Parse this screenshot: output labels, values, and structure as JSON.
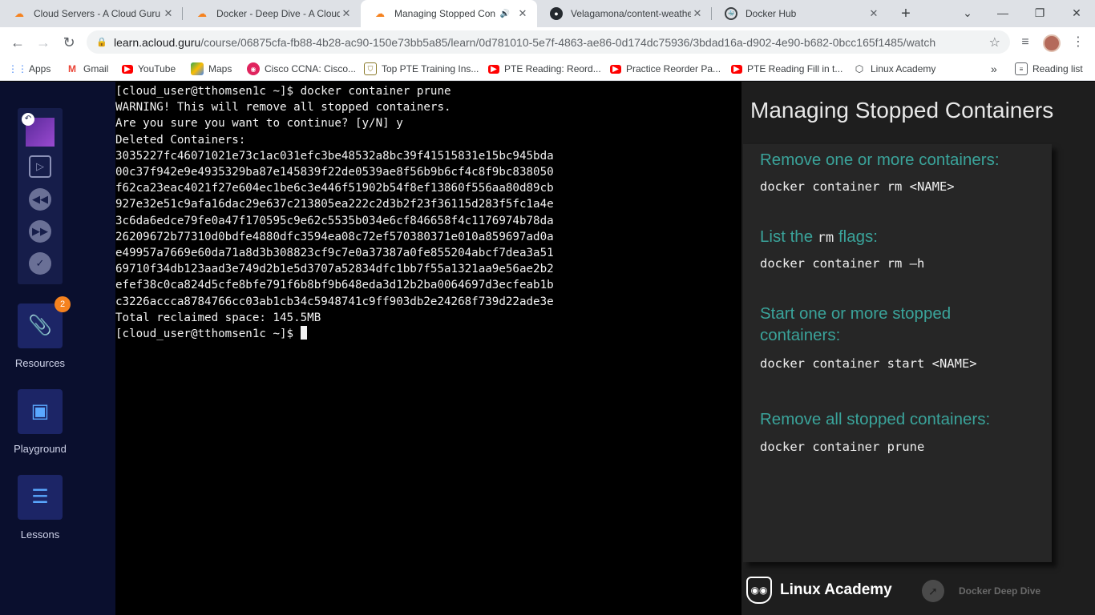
{
  "browser": {
    "tabs": [
      {
        "title": "Cloud Servers - A Cloud Guru",
        "icon": "cloud-icon",
        "active": false
      },
      {
        "title": "Docker - Deep Dive - A Cloud",
        "icon": "cloud-icon",
        "active": false
      },
      {
        "title": "Managing Stopped Conta",
        "icon": "cloud-icon",
        "active": true,
        "audio": "🔊"
      },
      {
        "title": "Velagamona/content-weathe",
        "icon": "github-icon",
        "active": false
      },
      {
        "title": "Docker Hub",
        "icon": "docker-icon",
        "active": false
      }
    ],
    "url_host": "learn.acloud.guru",
    "url_path": "/course/06875cfa-fb88-4b28-ac90-150e73bb5a85/learn/0d781010-5e7f-4863-ae86-0d174dc75936/3bdad16a-d902-4e90-b682-0bcc165f1485/watch",
    "bookmarks": [
      {
        "label": "Apps",
        "icon": "apps-grid-icon"
      },
      {
        "label": "Gmail",
        "icon": "gmail-icon"
      },
      {
        "label": "YouTube",
        "icon": "youtube-icon"
      },
      {
        "label": "Maps",
        "icon": "maps-icon"
      },
      {
        "label": "Cisco CCNA: Cisco...",
        "icon": "cisco-icon"
      },
      {
        "label": "Top PTE Training Ins...",
        "icon": "pte-icon"
      },
      {
        "label": "PTE Reading: Reord...",
        "icon": "youtube-icon"
      },
      {
        "label": "Practice Reorder Pa...",
        "icon": "youtube-icon"
      },
      {
        "label": "PTE Reading Fill in t...",
        "icon": "youtube-icon"
      },
      {
        "label": "Linux Academy",
        "icon": "linux-academy-icon"
      }
    ],
    "bookmarks_overflow": "»",
    "reading_list": "Reading list"
  },
  "sidebar": {
    "resources_label": "Resources",
    "resources_badge": "2",
    "playground_label": "Playground",
    "lessons_label": "Lessons"
  },
  "terminal": {
    "lines": [
      "[cloud_user@tthomsen1c ~]$ docker container prune",
      "WARNING! This will remove all stopped containers.",
      "Are you sure you want to continue? [y/N] y",
      "Deleted Containers:",
      "3035227fc46071021e73c1ac031efc3be48532a8bc39f41515831e15bc945bda",
      "00c37f942e9e4935329ba87e145839f22de0539ae8f56b9b6cf4c8f9bc838050",
      "f62ca23eac4021f27e604ec1be6c3e446f51902b54f8ef13860f556aa80d89cb",
      "927e32e51c9afa16dac29e637c213805ea222c2d3b2f23f36115d283f5fc1a4e",
      "3c6da6edce79fe0a47f170595c9e62c5535b034e6cf846658f4c1176974b78da",
      "26209672b77310d0bdfe4880dfc3594ea08c72ef570380371e010a859697ad0a",
      "e49957a7669e60da71a8d3b308823cf9c7e0a37387a0fe855204abcf7dea3a51",
      "69710f34db123aad3e749d2b1e5d3707a52834dfc1bb7f55a1321aa9e56ae2b2",
      "efef38c0ca824d5cfe8bfe791f6b8bf9b648eda3d12b2ba0064697d3ecfeab1b",
      "c3226accca8784766cc03ab1cb34c5948741c9ff903db2e24268f739d22ade3e",
      "",
      "Total reclaimed space: 145.5MB"
    ],
    "prompt": "[cloud_user@tthomsen1c ~]$ "
  },
  "slide": {
    "title": "Managing Stopped Containers",
    "sections": [
      {
        "head": "Remove one or more containers:",
        "cmd": "docker container rm <NAME>"
      },
      {
        "head_pre": "List the ",
        "head_mono": "rm",
        "head_post": " flags:",
        "cmd": "docker container rm –h"
      },
      {
        "head": "Start one or more stopped",
        "head2": "containers:",
        "cmd": "docker container start <NAME>"
      },
      {
        "head": "Remove all stopped containers:",
        "cmd": "docker container prune"
      }
    ],
    "brand": "Linux Academy",
    "course": "Docker Deep Dive"
  },
  "colors": {
    "accent": "#3aa39a",
    "nav_bg": "#0a0f2e",
    "badge": "#f5821f"
  }
}
